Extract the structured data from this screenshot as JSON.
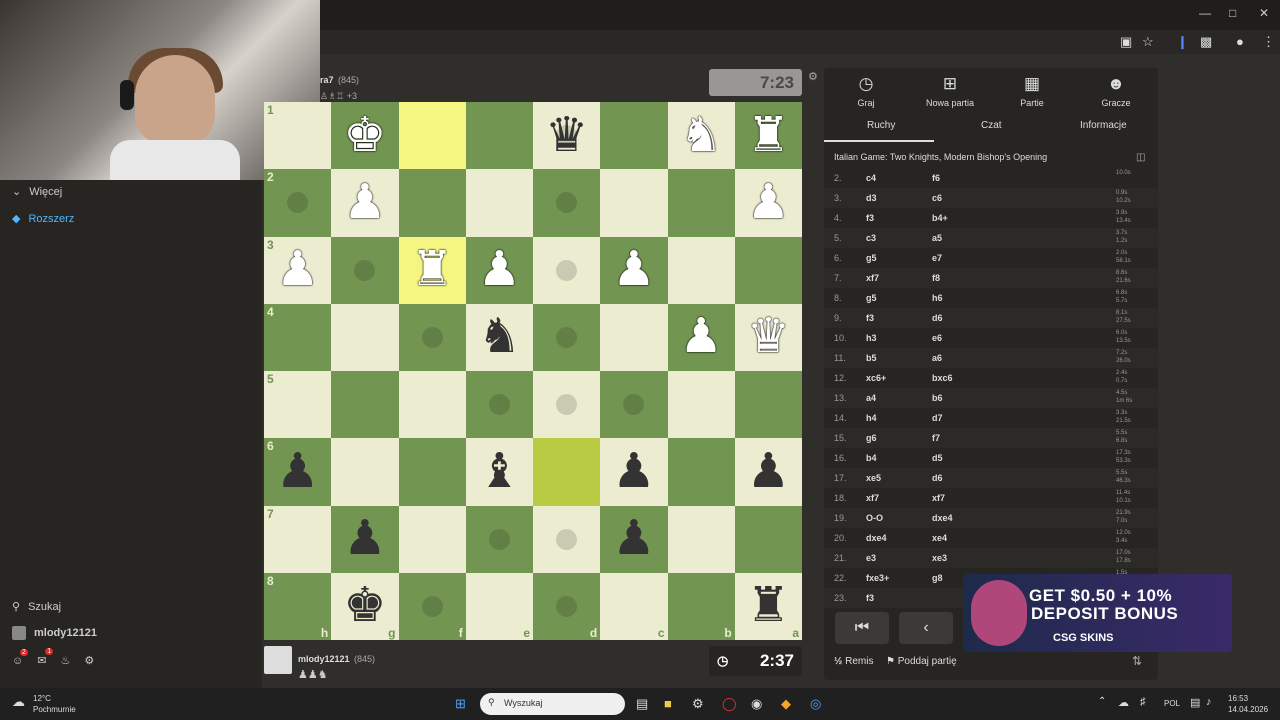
{
  "browser": {
    "icons": [
      "minimize-icon",
      "maximize-icon",
      "close-icon"
    ]
  },
  "webcam": {
    "label": "streamer webcam overlay"
  },
  "sidebar": {
    "more": "Więcej",
    "expand": "Rozszerz",
    "search": "Szukaj",
    "username": "mlody12121",
    "notif_badges": [
      "2",
      "1"
    ]
  },
  "top_player": {
    "name": "ra7",
    "rating": "(845)",
    "extra": "+3",
    "clock": "7:23"
  },
  "bottom_player": {
    "name": "mlody12121",
    "rating": "(845)",
    "clock": "2:37"
  },
  "board": {
    "ranks": [
      "1",
      "2",
      "3",
      "4",
      "5",
      "6",
      "7",
      "8"
    ],
    "files": [
      "h",
      "g",
      "f",
      "e",
      "d",
      "c",
      "b",
      "a"
    ],
    "rows": [
      [
        "",
        "wK",
        "",
        "",
        "bQ",
        "",
        "wN",
        "wR"
      ],
      [
        "",
        "wP",
        "",
        "",
        "",
        "",
        "",
        "wP"
      ],
      [
        "wP",
        "",
        "wR",
        "wP",
        "",
        "wP",
        "",
        ""
      ],
      [
        "",
        "",
        "",
        "bN",
        "",
        "",
        "wP",
        "wQ"
      ],
      [
        "",
        "",
        "",
        "",
        "",
        "",
        "",
        ""
      ],
      [
        "bP",
        "",
        "",
        "bB",
        "",
        "bP",
        "",
        "bP"
      ],
      [
        "",
        "bP",
        "",
        "",
        "",
        "bP",
        "",
        ""
      ],
      [
        "",
        "bK",
        "",
        "",
        "",
        "",
        "",
        "bR"
      ]
    ],
    "highlights": {
      "yellow": [
        "0-2",
        "2-2"
      ],
      "green": [
        "5-4"
      ]
    },
    "moveDots": [
      "0-4",
      "1-0",
      "1-4",
      "2-1",
      "2-4",
      "3-2",
      "3-4",
      "4-3",
      "4-4",
      "4-5",
      "6-3",
      "6-4",
      "7-2",
      "7-4"
    ]
  },
  "panel": {
    "tabs": [
      {
        "icon": "stopwatch-icon",
        "label": "Graj"
      },
      {
        "icon": "plus-icon",
        "label": "Nowa partia"
      },
      {
        "icon": "board-icon",
        "label": "Partie"
      },
      {
        "icon": "players-icon",
        "label": "Gracze"
      }
    ],
    "subtabs": [
      "Ruchy",
      "Czat",
      "Informacje"
    ],
    "opening": "Italian Game: Two Knights, Modern Bishop's Opening",
    "moves": [
      {
        "n": "2.",
        "w": "c4",
        "b": "f6",
        "tw": "10.0s",
        "tb": ""
      },
      {
        "n": "3.",
        "w": "d3",
        "b": "c6",
        "tw": "0.9s",
        "tb": "10.2s"
      },
      {
        "n": "4.",
        "w": "f3",
        "b": "b4+",
        "tw": "3.9s",
        "tb": "13.4s"
      },
      {
        "n": "5.",
        "w": "c3",
        "b": "a5",
        "tw": "3.7s",
        "tb": "1.2s"
      },
      {
        "n": "6.",
        "w": "g5",
        "b": "e7",
        "tw": "2.0s",
        "tb": "58.1s"
      },
      {
        "n": "7.",
        "w": "xf7",
        "b": "f8",
        "tw": "8.6s",
        "tb": "21.6s"
      },
      {
        "n": "8.",
        "w": "g5",
        "b": "h6",
        "tw": "6.8s",
        "tb": "5.7s"
      },
      {
        "n": "9.",
        "w": "f3",
        "b": "d6",
        "tw": "8.1s",
        "tb": "27.5s"
      },
      {
        "n": "10.",
        "w": "h3",
        "b": "e6",
        "tw": "6.0s",
        "tb": "13.5s"
      },
      {
        "n": "11.",
        "w": "b5",
        "b": "a6",
        "tw": "7.2s",
        "tb": "26.0s"
      },
      {
        "n": "12.",
        "w": "xc6+",
        "b": "bxc6",
        "tw": "2.4s",
        "tb": "0.7s"
      },
      {
        "n": "13.",
        "w": "a4",
        "b": "b6",
        "tw": "4.5s",
        "tb": "1m 6s"
      },
      {
        "n": "14.",
        "w": "h4",
        "b": "d7",
        "tw": "3.3s",
        "tb": "21.5s"
      },
      {
        "n": "15.",
        "w": "g6",
        "b": "f7",
        "tw": "5.5s",
        "tb": "6.8s"
      },
      {
        "n": "16.",
        "w": "b4",
        "b": "d5",
        "tw": "17.3s",
        "tb": "53.3s"
      },
      {
        "n": "17.",
        "w": "xe5",
        "b": "d6",
        "tw": "5.5s",
        "tb": "46.3s"
      },
      {
        "n": "18.",
        "w": "xf7",
        "b": "xf7",
        "tw": "11.4s",
        "tb": "10.1s"
      },
      {
        "n": "19.",
        "w": "O-O",
        "b": "dxe4",
        "tw": "21.9s",
        "tb": "7.0s"
      },
      {
        "n": "20.",
        "w": "dxe4",
        "b": "xe4",
        "tw": "12.0s",
        "tb": "3.4s"
      },
      {
        "n": "21.",
        "w": "e3",
        "b": "xe3",
        "tw": "17.0s",
        "tb": "17.8s"
      },
      {
        "n": "22.",
        "w": "fxe3+",
        "b": "g8",
        "tw": "1.5s",
        "tb": ""
      },
      {
        "n": "23.",
        "w": "f3",
        "b": "",
        "tw": "",
        "tb": ""
      }
    ],
    "draw": "Remis",
    "resign": "Poddaj partię"
  },
  "ad": {
    "line1": "GET $0.50 + 10%",
    "line2": "DEPOSIT BONUS",
    "brand": "CSG SKINS"
  },
  "taskbar": {
    "weather_temp": "12°C",
    "weather_desc": "Pochmurnie",
    "search": "Wyszukaj",
    "lang": "POL",
    "time": "16:53",
    "date": "14.04.2026"
  }
}
